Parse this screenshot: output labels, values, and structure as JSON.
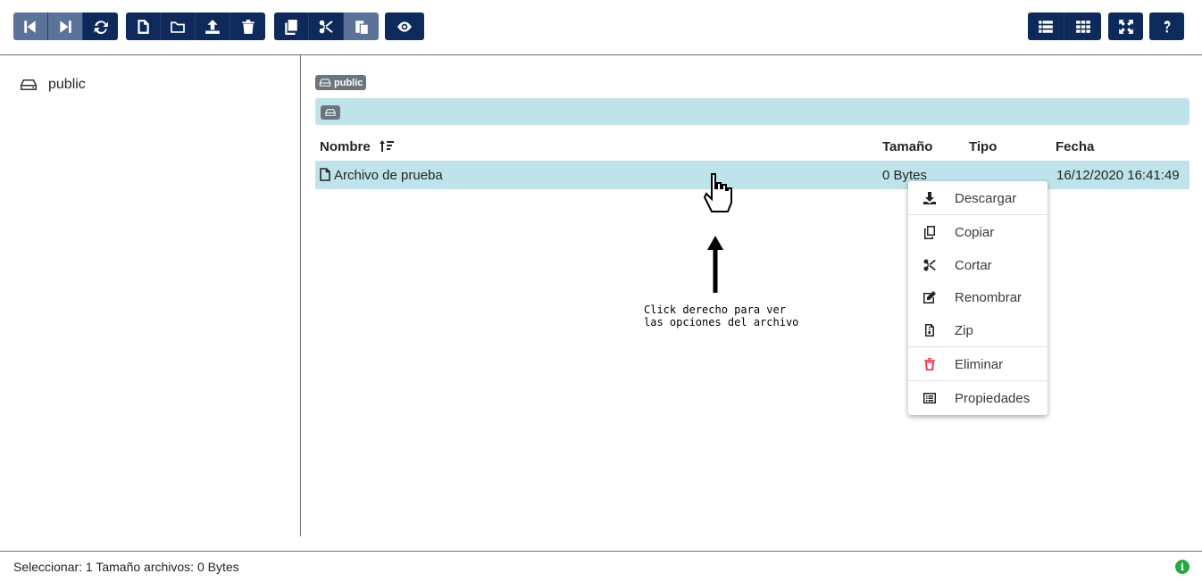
{
  "toolbar": {
    "groups": [
      [
        "back-icon",
        "forward-icon",
        "refresh-icon"
      ],
      [
        "new-file-icon",
        "new-folder-icon",
        "upload-icon",
        "delete-icon"
      ],
      [
        "copy-icon",
        "cut-icon",
        "paste-icon"
      ],
      [
        "preview-icon"
      ],
      [
        "list-view-icon",
        "grid-view-icon"
      ],
      [
        "fullscreen-icon"
      ],
      [
        "help-icon"
      ]
    ]
  },
  "sidebar": {
    "items": [
      {
        "label": "public",
        "icon": "disk-icon"
      }
    ]
  },
  "breadcrumb": {
    "label": "public",
    "icon": "disk-icon"
  },
  "table": {
    "headers": {
      "name": "Nombre",
      "size": "Tamaño",
      "type": "Tipo",
      "date": "Fecha"
    },
    "rows": [
      {
        "name": "Archivo de prueba",
        "size": "0 Bytes",
        "type": "",
        "date": "16/12/2020 16:41:49",
        "selected": true
      }
    ]
  },
  "annotation": {
    "line1": "Click derecho para ver",
    "line2": "las opciones del archivo"
  },
  "context_menu": {
    "items": [
      {
        "label": "Descargar",
        "icon": "download-icon"
      },
      {
        "label": "Copiar",
        "icon": "copy-icon"
      },
      {
        "label": "Cortar",
        "icon": "cut-icon"
      },
      {
        "label": "Renombrar",
        "icon": "edit-icon"
      },
      {
        "label": "Zip",
        "icon": "zip-icon"
      },
      {
        "label": "Eliminar",
        "icon": "trash-icon"
      },
      {
        "label": "Propiedades",
        "icon": "properties-icon"
      }
    ]
  },
  "status": {
    "text": "Seleccionar: 1 Tamaño archivos: 0 Bytes",
    "icon": "info-icon"
  },
  "colors": {
    "toolbar_button": "#0e2a5a",
    "toolbar_button_disabled": "#5c7399",
    "selection": "#bfe3ea",
    "danger": "#dc3545",
    "info": "#28a745"
  }
}
